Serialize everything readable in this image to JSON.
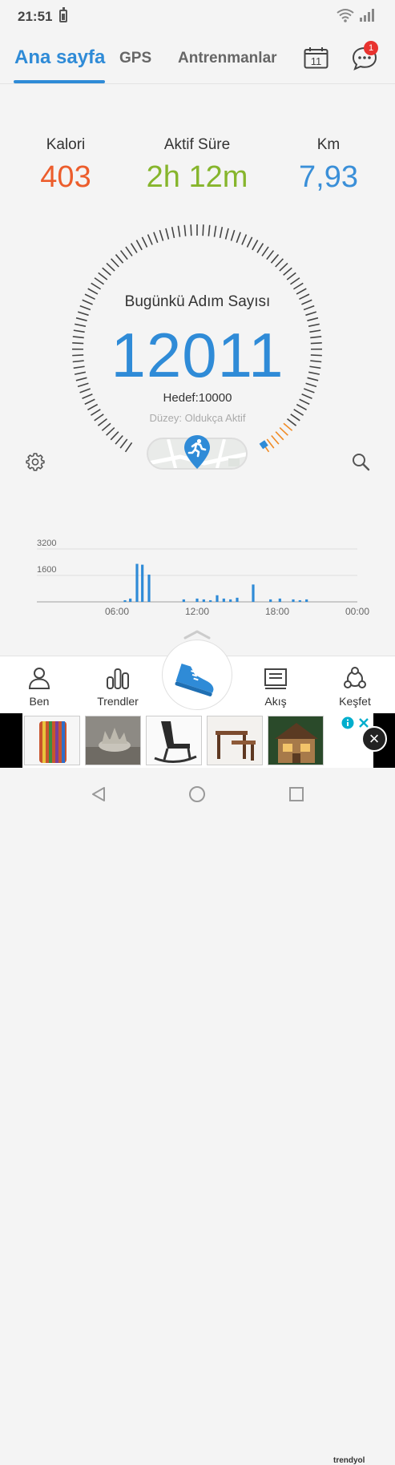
{
  "status_bar": {
    "time": "21:51"
  },
  "top_nav": {
    "tabs": [
      {
        "label": "Ana sayfa",
        "active": true
      },
      {
        "label": "GPS",
        "active": false
      },
      {
        "label": "Antrenmanlar",
        "active": false
      }
    ],
    "calendar_day": "11",
    "message_badge": "1"
  },
  "stats": {
    "calories": {
      "label": "Kalori",
      "value": "403",
      "color": "#ec5d2c"
    },
    "active_time": {
      "label": "Aktif Süre",
      "value": "2h 12m",
      "color": "#86b52c"
    },
    "distance": {
      "label": "Km",
      "value": "7,93",
      "color": "#3a8fd8"
    }
  },
  "steps": {
    "title": "Bugünkü Adım Sayısı",
    "count": "12011",
    "target": "Hedef:10000",
    "level": "Düzey: Oldukça Aktif",
    "goal_progress": 1.2
  },
  "chart_data": {
    "type": "bar",
    "x_ticks": [
      "06:00",
      "12:00",
      "18:00",
      "00:00"
    ],
    "y_ticks": [
      "3200",
      "1600"
    ],
    "ylim": [
      0,
      4800
    ],
    "color": "#2f8bd7",
    "bars": [
      {
        "x": 6.6,
        "y": 100
      },
      {
        "x": 7.0,
        "y": 200
      },
      {
        "x": 7.5,
        "y": 2300
      },
      {
        "x": 7.9,
        "y": 2250
      },
      {
        "x": 8.4,
        "y": 1650
      },
      {
        "x": 11.0,
        "y": 150
      },
      {
        "x": 12.0,
        "y": 200
      },
      {
        "x": 12.5,
        "y": 150
      },
      {
        "x": 13.0,
        "y": 100
      },
      {
        "x": 13.5,
        "y": 400
      },
      {
        "x": 14.0,
        "y": 200
      },
      {
        "x": 14.5,
        "y": 150
      },
      {
        "x": 15.0,
        "y": 250
      },
      {
        "x": 16.2,
        "y": 1050
      },
      {
        "x": 17.5,
        "y": 150
      },
      {
        "x": 18.2,
        "y": 200
      },
      {
        "x": 19.2,
        "y": 150
      },
      {
        "x": 19.7,
        "y": 100
      },
      {
        "x": 20.2,
        "y": 150
      }
    ]
  },
  "bottom_nav": {
    "items": [
      {
        "label": "Ben"
      },
      {
        "label": "Trendler"
      },
      {
        "label": "Akış"
      },
      {
        "label": "Keşfet"
      }
    ]
  },
  "ad": {
    "brand": "trendyol"
  },
  "icons": {
    "settings": "gear-icon",
    "search": "search-icon",
    "calendar": "calendar-icon",
    "messages": "chat-icon",
    "run": "running-shoe-icon"
  }
}
